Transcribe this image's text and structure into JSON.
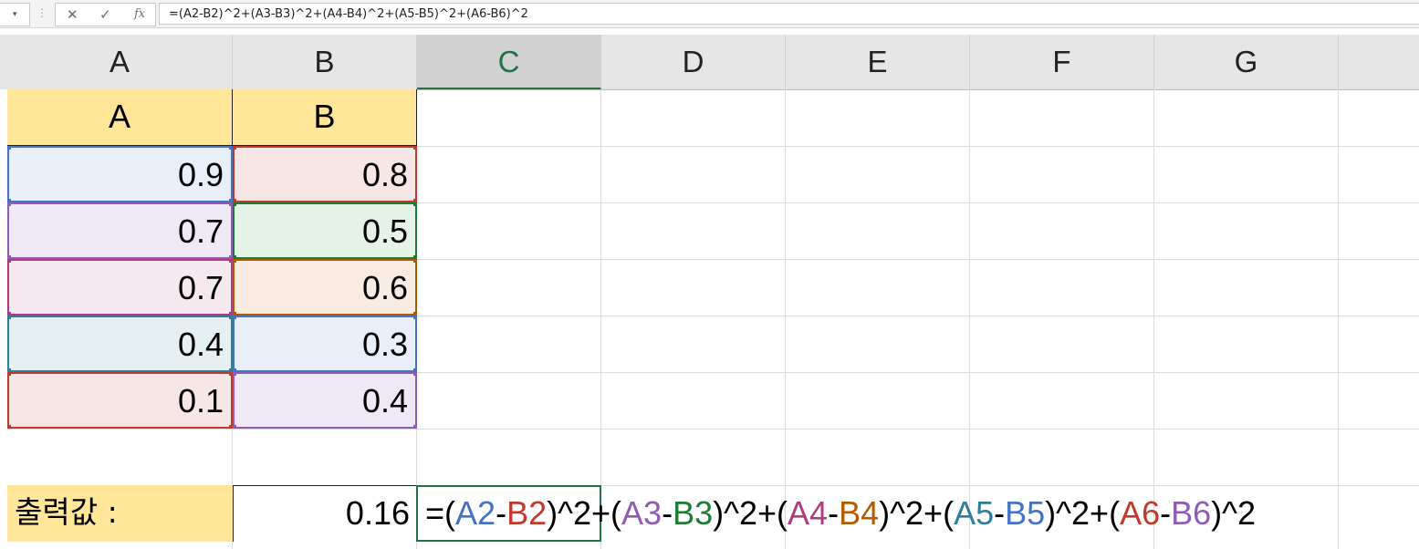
{
  "formula_bar": {
    "name_box_arrow": "▾",
    "separator": "⋮",
    "cancel_icon": "✕",
    "enter_icon": "✓",
    "fx_label": "fx",
    "formula": "=(A2-B2)^2+(A3-B3)^2+(A4-B4)^2+(A5-B5)^2+(A6-B6)^2"
  },
  "columns": [
    "A",
    "B",
    "C",
    "D",
    "E",
    "F",
    "G"
  ],
  "selected_column": "C",
  "table": {
    "headers": [
      "A",
      "B"
    ],
    "rows": [
      {
        "a": "0.9",
        "b": "0.8"
      },
      {
        "a": "0.7",
        "b": "0.5"
      },
      {
        "a": "0.7",
        "b": "0.6"
      },
      {
        "a": "0.4",
        "b": "0.3"
      },
      {
        "a": "0.1",
        "b": "0.4"
      }
    ]
  },
  "output": {
    "label": "출력값 :",
    "value": "0.16"
  },
  "formula_cell": {
    "tokens": [
      {
        "text": "=(",
        "color": "#000000"
      },
      {
        "text": "A2",
        "color": "#4472c4"
      },
      {
        "text": "-",
        "color": "#000000"
      },
      {
        "text": "B2",
        "color": "#c0392b"
      },
      {
        "text": ")^2+(",
        "color": "#000000"
      },
      {
        "text": "A3",
        "color": "#8e5bb5"
      },
      {
        "text": "-",
        "color": "#000000"
      },
      {
        "text": "B3",
        "color": "#1e7b34"
      },
      {
        "text": ")^2+(",
        "color": "#000000"
      },
      {
        "text": "A4",
        "color": "#b03a7f"
      },
      {
        "text": "-",
        "color": "#000000"
      },
      {
        "text": "B4",
        "color": "#b35a00"
      },
      {
        "text": ")^2+(",
        "color": "#000000"
      },
      {
        "text": "A5",
        "color": "#2e7d9a"
      },
      {
        "text": "-",
        "color": "#000000"
      },
      {
        "text": "B5",
        "color": "#4472c4"
      },
      {
        "text": ")^2+(",
        "color": "#000000"
      },
      {
        "text": "A6",
        "color": "#c0392b"
      },
      {
        "text": "-",
        "color": "#000000"
      },
      {
        "text": "B6",
        "color": "#8e5bb5"
      },
      {
        "text": ")^2",
        "color": "#000000"
      }
    ]
  },
  "reference_colors": {
    "row2": {
      "a_fill": "#e9eff8",
      "a_border": "#4472c4",
      "b_fill": "#f7e6e6",
      "b_border": "#c0392b"
    },
    "row3": {
      "a_fill": "#efe9f5",
      "a_border": "#8e5bb5",
      "b_fill": "#e5f2e7",
      "b_border": "#1e7b34"
    },
    "row4": {
      "a_fill": "#f5e8ef",
      "a_border": "#b03a7f",
      "b_fill": "#f8ebe1",
      "b_border": "#b35a00"
    },
    "row5": {
      "a_fill": "#e6f0f3",
      "a_border": "#2e7d9a",
      "b_fill": "#e9eff8",
      "b_border": "#4472c4"
    },
    "row6": {
      "a_fill": "#f7e6e6",
      "a_border": "#c0392b",
      "b_fill": "#efe9f5",
      "b_border": "#8e5bb5"
    }
  },
  "header_fill": "#ffe699",
  "accent": "#217346"
}
